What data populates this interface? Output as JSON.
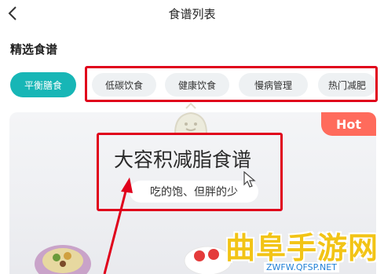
{
  "header": {
    "title": "食谱列表"
  },
  "section": {
    "title": "精选食谱"
  },
  "categories": {
    "active": "平衡膳食",
    "items": [
      "低碳饮食",
      "健康饮食",
      "慢病管理",
      "热门减肥"
    ]
  },
  "banner": {
    "badge": "Hot",
    "title": "大容积减脂食谱",
    "subtitle": "吃的饱、但胖的少"
  },
  "watermark": {
    "text": "曲阜手游网",
    "url": "ZWFW.QFSP.NET"
  },
  "colors": {
    "accent": "#17b6b6",
    "badge": "#ff6b5c",
    "annotation": "#e0001b",
    "watermark": "#f2c416"
  },
  "icons": [
    "back-icon",
    "cursor-icon",
    "food-plate-illustration",
    "watermark-logo-icon"
  ]
}
